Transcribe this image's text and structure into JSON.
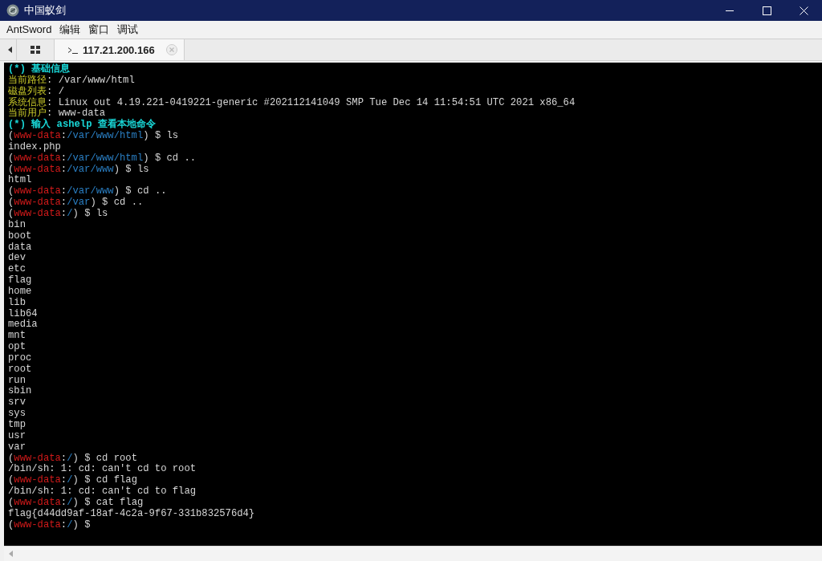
{
  "window": {
    "title": "中国蚁剑"
  },
  "menu": [
    "AntSword",
    "编辑",
    "窗口",
    "调试"
  ],
  "tabs": [
    {
      "label": "117.21.200.166",
      "selected": true
    }
  ],
  "terminal": {
    "lines": [
      {
        "kind": "header",
        "text": "(*) 基础信息"
      },
      {
        "kind": "info",
        "label": "当前路径",
        "value": ": /var/www/html"
      },
      {
        "kind": "info",
        "label": "磁盘列表",
        "value": ": /"
      },
      {
        "kind": "info",
        "label": "系统信息",
        "value": ": Linux out 4.19.221-0419221-generic #202112141049 SMP Tue Dec 14 11:54:51 UTC 2021 x86_64"
      },
      {
        "kind": "info",
        "label": "当前用户",
        "value": ": www-data"
      },
      {
        "kind": "header",
        "text": "(*) 输入 ashelp 查看本地命令"
      },
      {
        "kind": "prompt",
        "open": "(",
        "user": "www-data",
        "colon": ":",
        "path": "/var/www/html",
        "close": ") $",
        "command": "ls"
      },
      {
        "kind": "output",
        "text": "index.php"
      },
      {
        "kind": "prompt",
        "open": "(",
        "user": "www-data",
        "colon": ":",
        "path": "/var/www/html",
        "close": ") $",
        "command": "cd .."
      },
      {
        "kind": "prompt",
        "open": "(",
        "user": "www-data",
        "colon": ":",
        "path": "/var/www",
        "close": ") $",
        "command": "ls"
      },
      {
        "kind": "output",
        "text": "html"
      },
      {
        "kind": "prompt",
        "open": "(",
        "user": "www-data",
        "colon": ":",
        "path": "/var/www",
        "close": ") $",
        "command": "cd .."
      },
      {
        "kind": "prompt",
        "open": "(",
        "user": "www-data",
        "colon": ":",
        "path": "/var",
        "close": ") $",
        "command": "cd .."
      },
      {
        "kind": "prompt",
        "open": "(",
        "user": "www-data",
        "colon": ":",
        "path": "/",
        "close": ") $",
        "command": "ls"
      },
      {
        "kind": "output",
        "text": "bin"
      },
      {
        "kind": "output",
        "text": "boot"
      },
      {
        "kind": "output",
        "text": "data"
      },
      {
        "kind": "output",
        "text": "dev"
      },
      {
        "kind": "output",
        "text": "etc"
      },
      {
        "kind": "output",
        "text": "flag"
      },
      {
        "kind": "output",
        "text": "home"
      },
      {
        "kind": "output",
        "text": "lib"
      },
      {
        "kind": "output",
        "text": "lib64"
      },
      {
        "kind": "output",
        "text": "media"
      },
      {
        "kind": "output",
        "text": "mnt"
      },
      {
        "kind": "output",
        "text": "opt"
      },
      {
        "kind": "output",
        "text": "proc"
      },
      {
        "kind": "output",
        "text": "root"
      },
      {
        "kind": "output",
        "text": "run"
      },
      {
        "kind": "output",
        "text": "sbin"
      },
      {
        "kind": "output",
        "text": "srv"
      },
      {
        "kind": "output",
        "text": "sys"
      },
      {
        "kind": "output",
        "text": "tmp"
      },
      {
        "kind": "output",
        "text": "usr"
      },
      {
        "kind": "output",
        "text": "var"
      },
      {
        "kind": "prompt",
        "open": "(",
        "user": "www-data",
        "colon": ":",
        "path": "/",
        "close": ") $",
        "command": "cd root"
      },
      {
        "kind": "output",
        "text": "/bin/sh: 1: cd: can't cd to root"
      },
      {
        "kind": "prompt",
        "open": "(",
        "user": "www-data",
        "colon": ":",
        "path": "/",
        "close": ") $",
        "command": "cd flag"
      },
      {
        "kind": "output",
        "text": "/bin/sh: 1: cd: can't cd to flag"
      },
      {
        "kind": "prompt",
        "open": "(",
        "user": "www-data",
        "colon": ":",
        "path": "/",
        "close": ") $",
        "command": "cat flag"
      },
      {
        "kind": "output",
        "text": "flag{d44dd9af-18af-4c2a-9f67-331b832576d4}"
      },
      {
        "kind": "prompt",
        "open": "(",
        "user": "www-data",
        "colon": ":",
        "path": "/",
        "close": ") $"
      }
    ]
  }
}
